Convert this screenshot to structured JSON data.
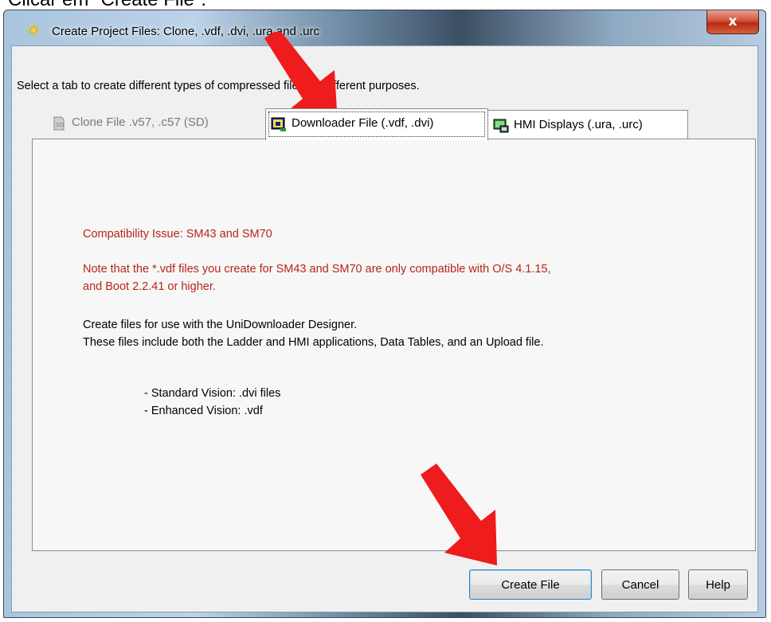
{
  "caption": "Clicar em \"Create File\".",
  "window": {
    "title": "Create Project Files: Clone, .vdf, .dvi, .ura and .urc",
    "close_label": "x"
  },
  "instruction": "Select a tab to create different types of compressed files for different purposes.",
  "tabs": [
    {
      "label": "Clone File .v57, .c57 (SD)",
      "state": "disabled",
      "icon": "sd-card-icon"
    },
    {
      "label": "Downloader File (.vdf, .dvi)",
      "state": "active",
      "icon": "downloader-icon"
    },
    {
      "label": "HMI Displays (.ura, .urc)",
      "state": "inactive",
      "icon": "hmi-display-icon"
    }
  ],
  "panel": {
    "compat_title": "Compatibility Issue: SM43 and SM70",
    "compat_note_line1": "Note that the *.vdf files you create for SM43 and SM70 are only compatible with O/S 4.1.15,",
    "compat_note_line2": "and Boot 2.2.41 or higher.",
    "desc_line1": "Create files for use with the UniDownloader Designer.",
    "desc_line2": "These files include both the Ladder and HMI applications, Data Tables, and an Upload file.",
    "list": [
      "- Standard Vision: .dvi files",
      "- Enhanced Vision: .vdf"
    ]
  },
  "buttons": {
    "create": "Create File",
    "cancel": "Cancel",
    "help": "Help"
  },
  "colors": {
    "warning_text": "#b5261a",
    "annotation_arrow": "#ee1c1c",
    "close_button": "#c8432a"
  }
}
